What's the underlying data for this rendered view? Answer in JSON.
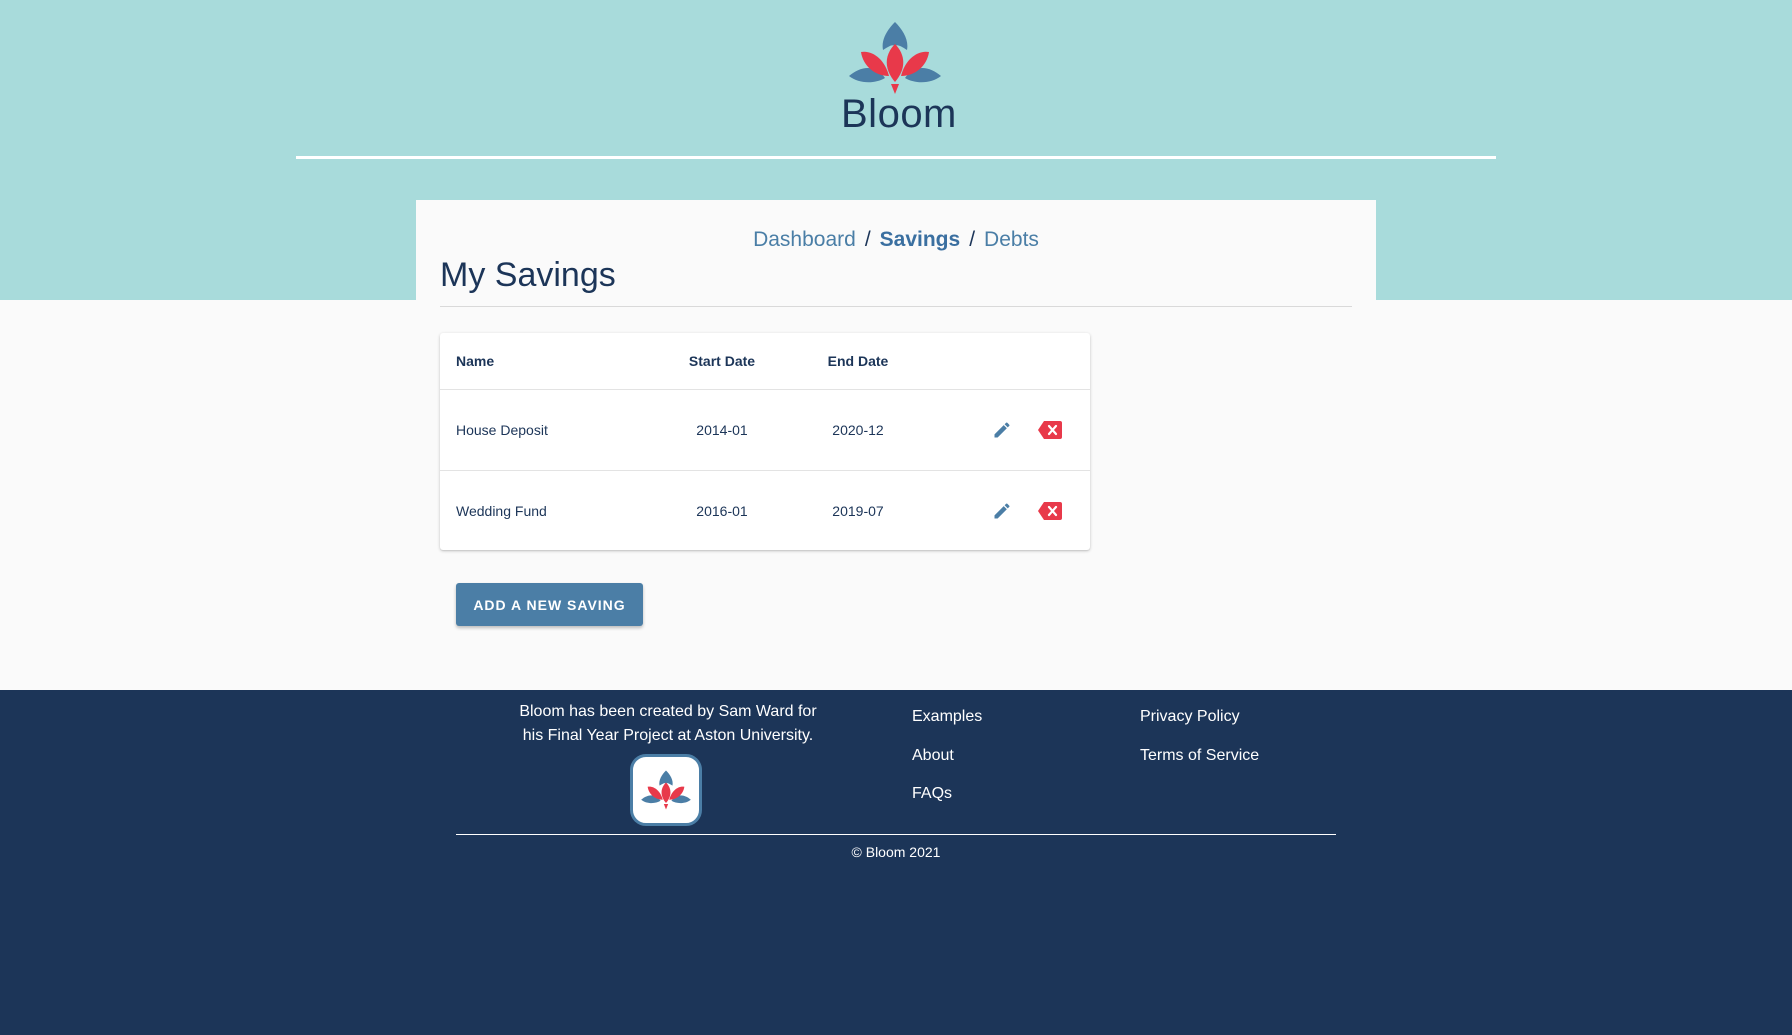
{
  "brand": {
    "name": "Bloom",
    "colors": {
      "primary": "#1c3558",
      "accent": "#e8394a",
      "secondary": "#4b7ea6",
      "hero": "#a8dbdb"
    }
  },
  "breadcrumb": {
    "items": [
      {
        "label": "Dashboard",
        "active": false
      },
      {
        "label": "Savings",
        "active": true
      },
      {
        "label": "Debts",
        "active": false
      }
    ],
    "separator": "/"
  },
  "page": {
    "title": "My Savings"
  },
  "table": {
    "columns": [
      "Name",
      "Start Date",
      "End Date"
    ],
    "rows": [
      {
        "name": "House Deposit",
        "start": "2014-01",
        "end": "2020-12"
      },
      {
        "name": "Wedding Fund",
        "start": "2016-01",
        "end": "2019-07"
      }
    ],
    "icons": {
      "edit": "pencil-icon",
      "delete": "backspace-x-icon"
    }
  },
  "actions": {
    "add_label": "ADD A NEW SAVING"
  },
  "footer": {
    "about_line1": "Bloom has been created by Sam Ward for",
    "about_line2": "his Final Year Project at Aston University.",
    "links_col1": [
      "Examples",
      "About",
      "FAQs"
    ],
    "links_col2": [
      "Privacy Policy",
      "Terms of Service"
    ],
    "copyright": "© Bloom 2021"
  }
}
